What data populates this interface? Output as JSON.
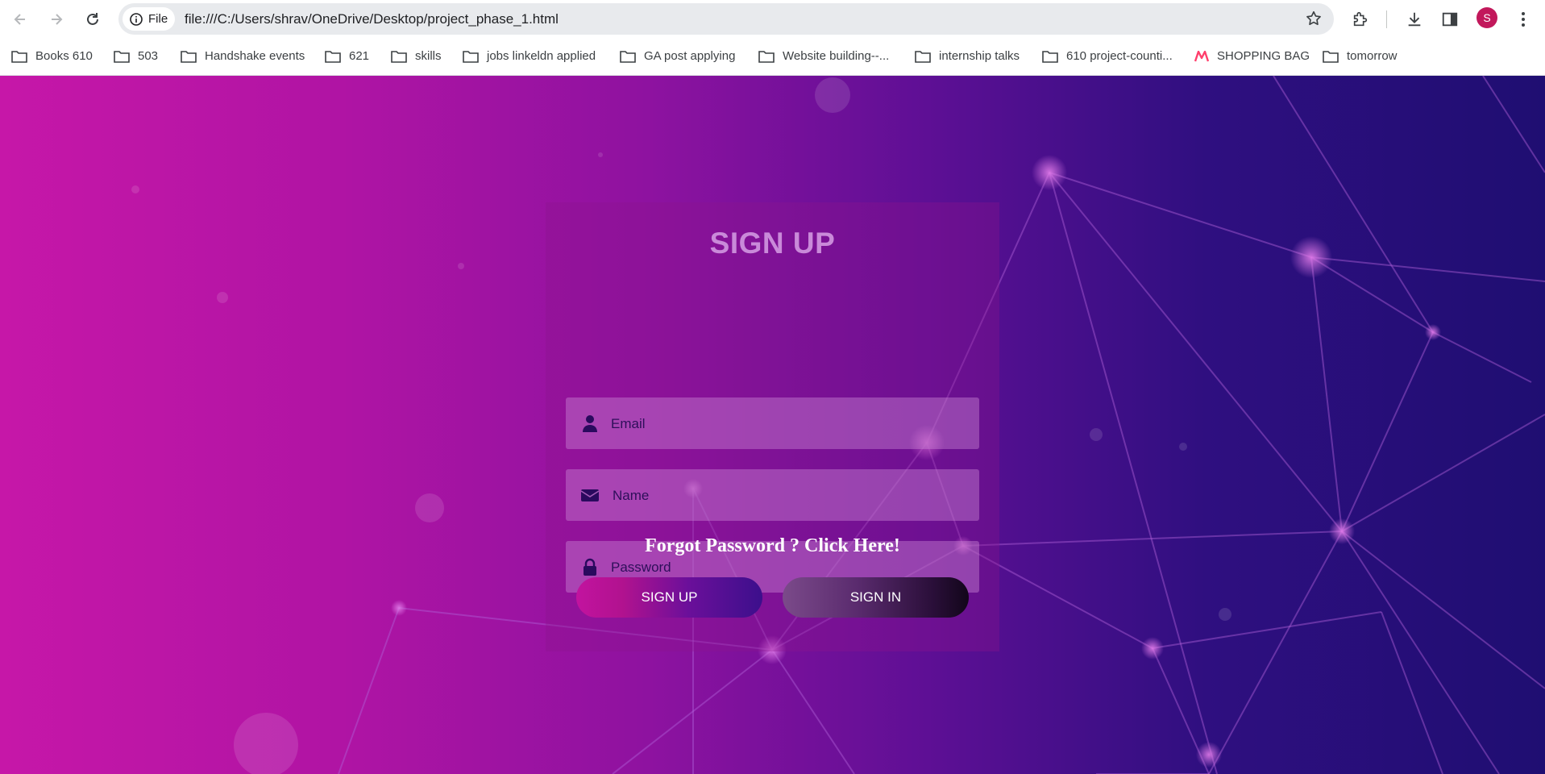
{
  "browser": {
    "url": "file:///C:/Users/shrav/OneDrive/Desktop/project_phase_1.html",
    "file_chip_label": "File",
    "profile_initial": "S",
    "bookmarks": [
      "Books 610",
      "503",
      "Handshake events",
      "621",
      "skills",
      "jobs linkeldn applied",
      "GA post applying",
      "Website building--...",
      "internship talks",
      "610 project-counti...",
      "SHOPPING BAG",
      "tomorrow"
    ]
  },
  "form": {
    "title": "SIGN UP",
    "email_placeholder": "Email",
    "name_placeholder": "Name",
    "password_placeholder": "Password",
    "email_icon": "person-icon",
    "name_icon": "envelope-icon",
    "password_icon": "lock-icon",
    "forgot_text": "Forgot Password ? Click Here!",
    "signup_label": "SIGN UP",
    "signin_label": "SIGN IN"
  },
  "colors": {
    "bg_left": "#c617a8",
    "bg_right": "#1f0e72",
    "title": "#c98ad9",
    "avatar": "#c2185b"
  }
}
